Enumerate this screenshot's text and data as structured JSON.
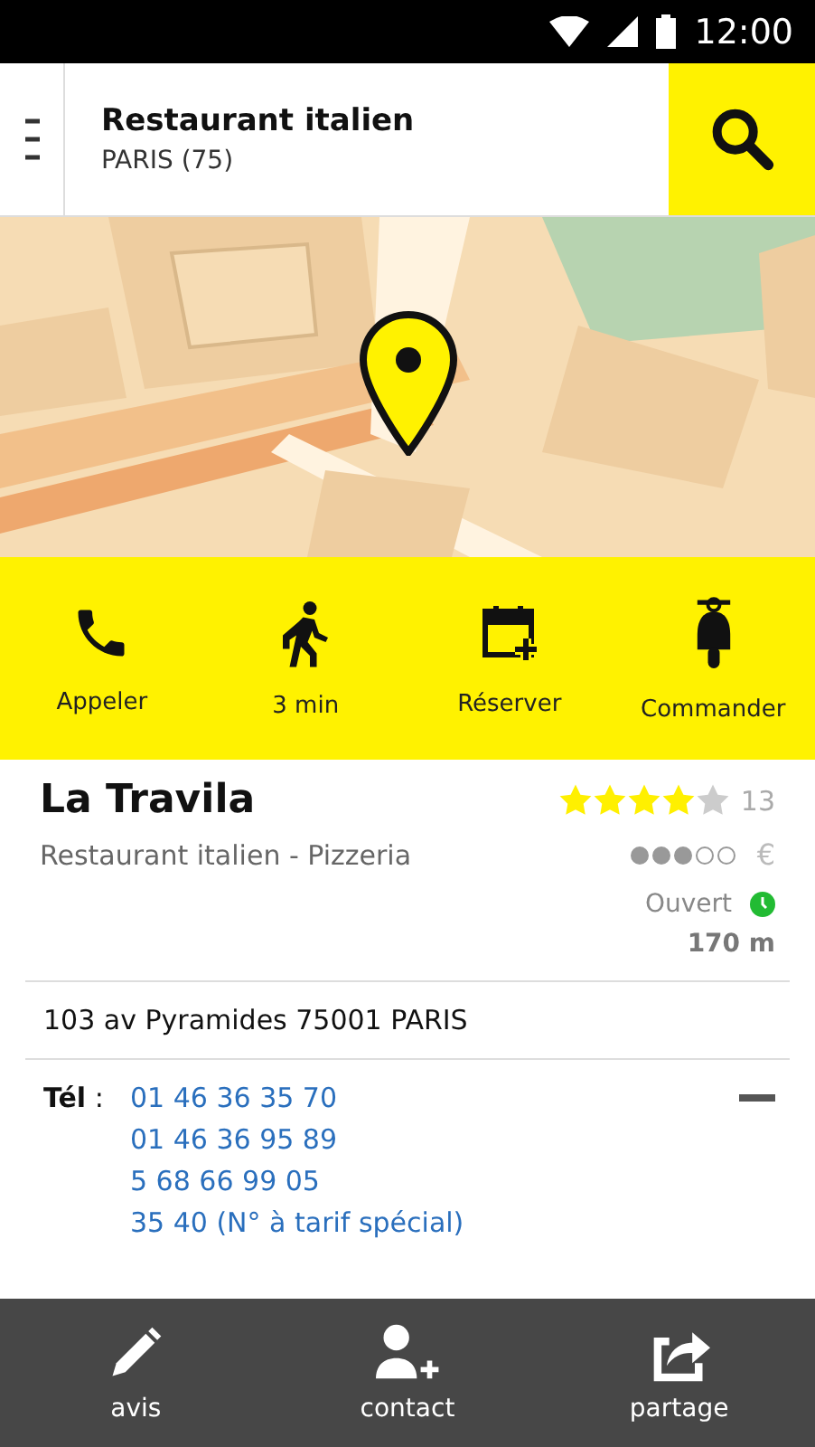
{
  "status_bar": {
    "time": "12:00"
  },
  "search": {
    "query": "Restaurant italien",
    "location": "PARIS (75)"
  },
  "actions": [
    {
      "kind": "phone",
      "label": "Appeler"
    },
    {
      "kind": "walk",
      "label": "3 min"
    },
    {
      "kind": "calendar",
      "label": "Réserver"
    },
    {
      "kind": "scooter",
      "label": "Commander"
    }
  ],
  "place": {
    "name": "La Travila",
    "category": "Restaurant italien - Pizzeria",
    "stars": 4,
    "reviews": "13",
    "price": {
      "dots": [
        {
          "filled": true
        },
        {
          "filled": true
        },
        {
          "filled": true
        },
        {
          "filled": false
        },
        {
          "filled": false
        }
      ],
      "symbol": "€"
    },
    "status": "Ouvert",
    "open": true,
    "distance": "170 m"
  },
  "address": "103 av Pyramides 75001 PARIS",
  "phones": {
    "label": "**Tél** :",
    "expanded": true,
    "numbers": [
      "01 46 36 35 70",
      "01 46 36 95 89",
      "5 68 66 99 05",
      "35 40 (N° à tarif spécial)"
    ]
  },
  "bottom_bar": [
    {
      "kind": "pen",
      "label": "avis"
    },
    {
      "kind": "contact",
      "label": "contact"
    },
    {
      "kind": "share",
      "label": "partage"
    }
  ]
}
